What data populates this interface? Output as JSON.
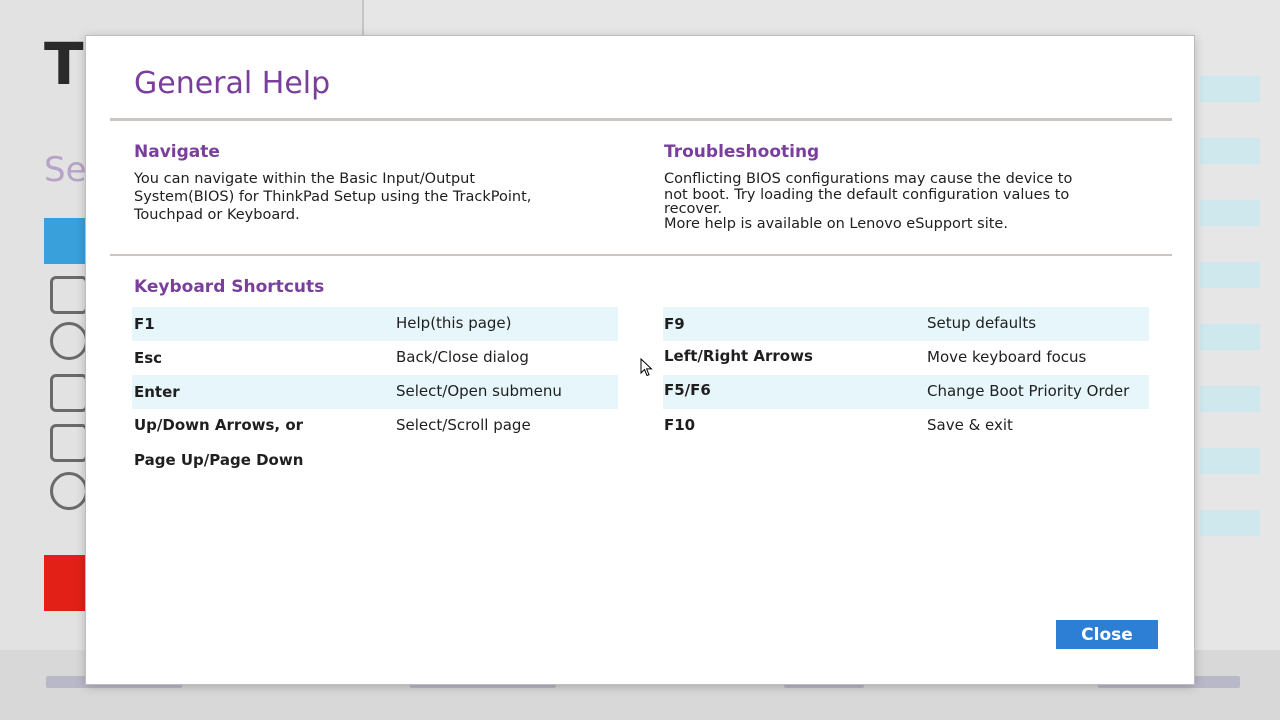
{
  "dialog": {
    "title": "General Help",
    "navigate": {
      "heading": "Navigate",
      "lines": [
        "You can navigate within the Basic Input/Output",
        "System(BIOS) for ThinkPad Setup using the TrackPoint,",
        "Touchpad or Keyboard."
      ]
    },
    "troubleshooting": {
      "heading": "Troubleshooting",
      "lines": [
        "Conflicting BIOS configurations may cause the device to",
        "not boot. Try loading the default configuration values to",
        "recover.",
        "More help is available on Lenovo eSupport site."
      ]
    },
    "shortcuts": {
      "heading": "Keyboard Shortcuts",
      "left": [
        {
          "key": "F1",
          "desc": "Help(this page)"
        },
        {
          "key": "Esc",
          "desc": "Back/Close dialog"
        },
        {
          "key": "Enter",
          "desc": "Select/Open submenu"
        },
        {
          "key": "Up/Down Arrows, or",
          "key2": "Page Up/Page Down",
          "desc": "Select/Scroll page"
        }
      ],
      "right": [
        {
          "key": "F9",
          "desc": "Setup defaults"
        },
        {
          "key": "Left/Right Arrows",
          "desc": "Move keyboard focus"
        },
        {
          "key": "F5/F6",
          "desc": "Change Boot Priority Order"
        },
        {
          "key": "F10",
          "desc": "Save & exit"
        }
      ]
    },
    "close_label": "Close"
  },
  "colors": {
    "accent": "#7a3f9c",
    "button": "#2d7fd6",
    "row_shade": "#e6f6fa",
    "divider": "#c9c6c4"
  },
  "icons": {
    "cursor": "mouse-pointer-icon"
  }
}
